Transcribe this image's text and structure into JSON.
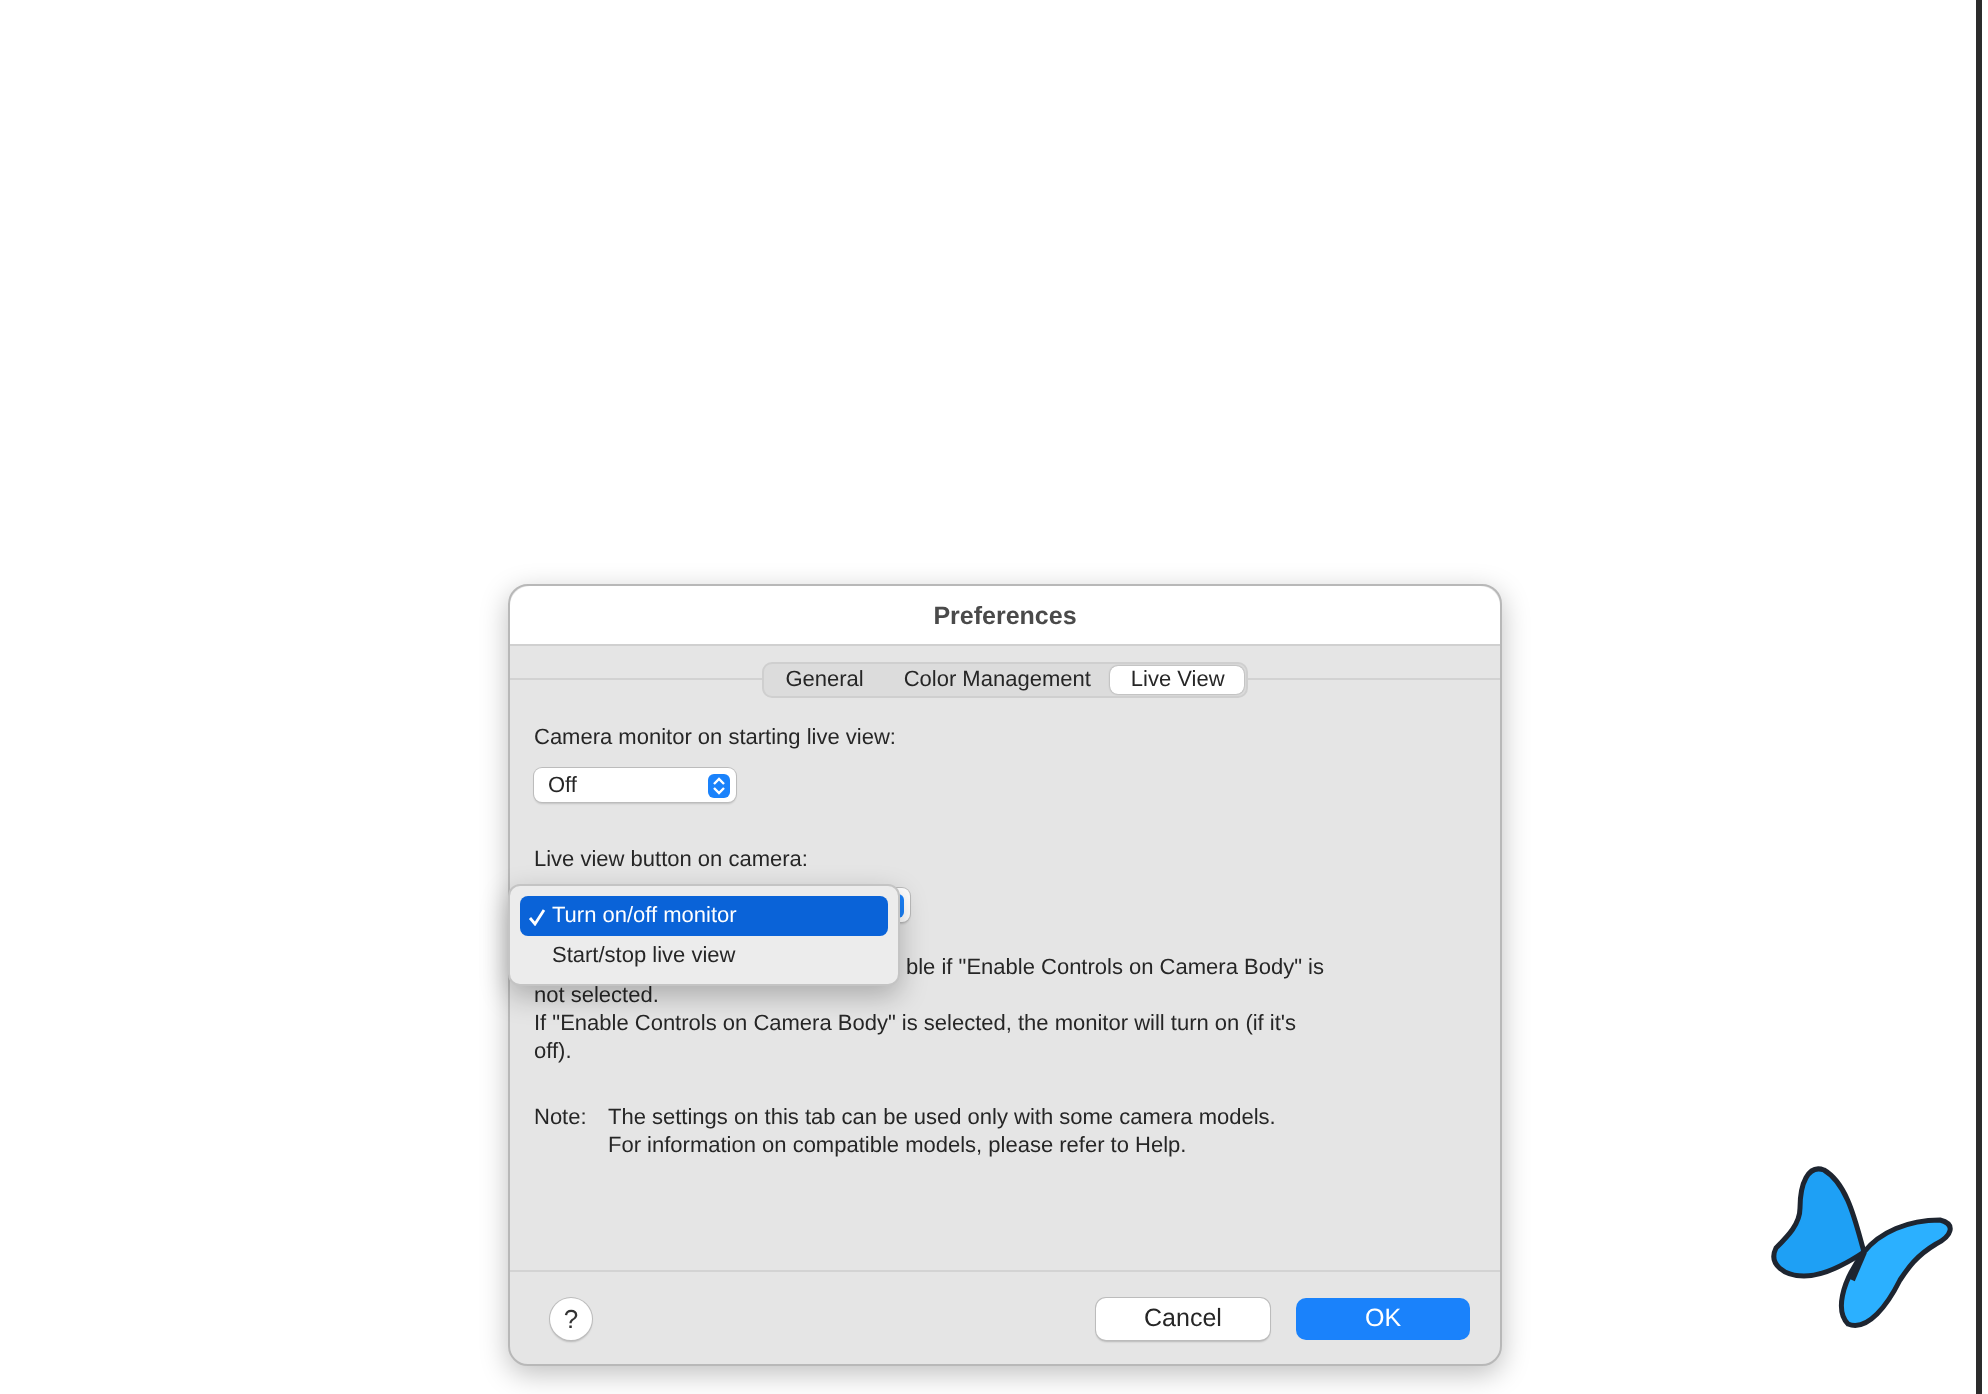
{
  "window": {
    "title": "Preferences"
  },
  "tabs": [
    {
      "label": "General",
      "selected": false
    },
    {
      "label": "Color Management",
      "selected": false
    },
    {
      "label": "Live View",
      "selected": true
    }
  ],
  "monitor_setting": {
    "label": "Camera monitor on starting live view:",
    "popup": {
      "value": "Off"
    }
  },
  "button_setting": {
    "label": "Live view button on camera:",
    "menu": [
      {
        "label": "Turn on/off monitor",
        "selected": true
      },
      {
        "label": "Start/stop live view",
        "selected": false
      }
    ]
  },
  "description": [
    "ble if \"Enable Controls on Camera Body\" is",
    "not selected.",
    "If \"Enable Controls on Camera Body\" is selected, the monitor will turn on (if it's off)."
  ],
  "note": {
    "label": "Note:",
    "lines": [
      "The settings on this tab can be used only with some camera models.",
      "For information on compatible models, please refer to Help."
    ]
  },
  "help_button": {
    "label": "?"
  },
  "buttons": [
    {
      "label": "Cancel",
      "kind": "secondary"
    },
    {
      "label": "OK",
      "kind": "default"
    }
  ]
}
